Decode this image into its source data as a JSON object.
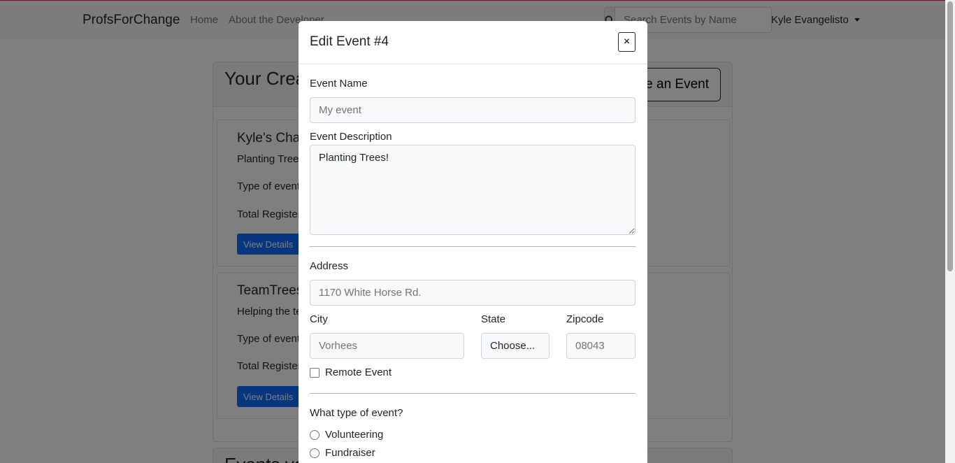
{
  "navbar": {
    "brand": "ProfsForChange",
    "links": [
      "Home",
      "About the Developer"
    ],
    "search_placeholder": "Search Events by Name",
    "user_name": "Kyle Evangelisto"
  },
  "page": {
    "section_title": "Your Crea",
    "create_button": "te an Event",
    "events": [
      {
        "title": "Kyle's Char",
        "description": "Planting Trees",
        "type_label": "Type of event",
        "registered_label": "Total Register",
        "button": "View Details"
      },
      {
        "title": "TeamTrees!",
        "description": "Helping the te",
        "type_label": "Type of event",
        "registered_label": "Total Register",
        "button": "View Details"
      }
    ],
    "section2_title": "Events yo"
  },
  "modal": {
    "title": "Edit Event #4",
    "close_label": "×",
    "event_name_label": "Event Name",
    "event_name_placeholder": "My event",
    "event_description_label": "Event Description",
    "event_description_value": "Planting Trees!",
    "address_label": "Address",
    "address_placeholder": "1170 White Horse Rd.",
    "city_label": "City",
    "city_placeholder": "Vorhees",
    "state_label": "State",
    "state_selected": "Choose...",
    "zip_label": "Zipcode",
    "zip_placeholder": "08043",
    "remote_label": "Remote Event",
    "type_question": "What type of event?",
    "type_options": [
      "Volunteering",
      "Fundraiser"
    ]
  }
}
